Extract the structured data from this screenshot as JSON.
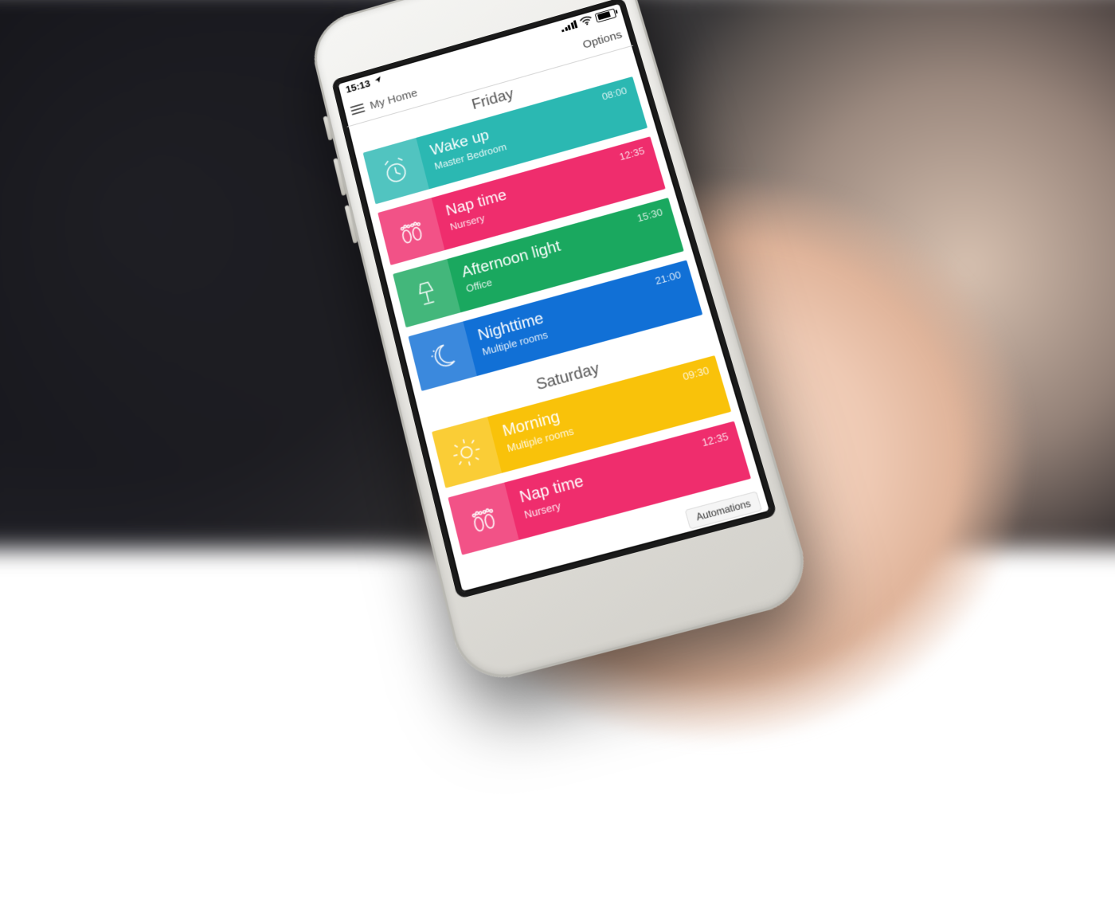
{
  "status": {
    "time": "15:13"
  },
  "nav": {
    "title": "My Home",
    "options": "Options"
  },
  "tabbar": {
    "active": "Automations"
  },
  "sections": [
    {
      "day": "Friday",
      "cards": [
        {
          "title": "Wake up",
          "sub": "Master Bedroom",
          "time": "08:00",
          "color": "c0",
          "icon": "alarm"
        },
        {
          "title": "Nap time",
          "sub": "Nursery",
          "time": "12:35",
          "color": "c1",
          "icon": "feet"
        },
        {
          "title": "Afternoon light",
          "sub": "Office",
          "time": "15:30",
          "color": "c2",
          "icon": "lamp"
        },
        {
          "title": "Nighttime",
          "sub": "Multiple rooms",
          "time": "21:00",
          "color": "c3",
          "icon": "moon"
        }
      ]
    },
    {
      "day": "Saturday",
      "cards": [
        {
          "title": "Morning",
          "sub": "Multiple rooms",
          "time": "09:30",
          "color": "c4",
          "icon": "sun"
        },
        {
          "title": "Nap time",
          "sub": "Nursery",
          "time": "12:35",
          "color": "c5",
          "icon": "feet"
        }
      ]
    }
  ]
}
